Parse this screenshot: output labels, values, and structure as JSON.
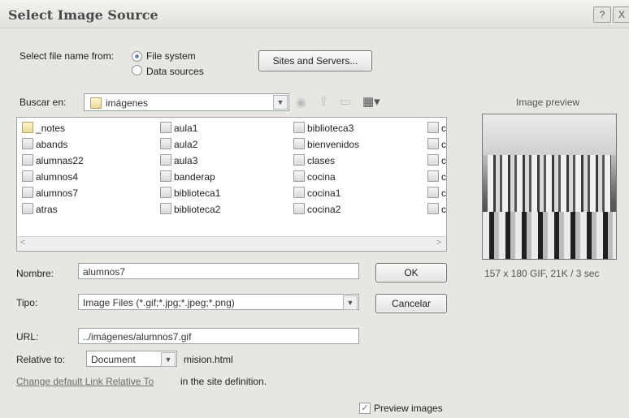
{
  "window": {
    "title": "Select Image Source",
    "help_glyph": "?",
    "close_glyph": "X"
  },
  "source": {
    "label": "Select file name from:",
    "options": [
      {
        "label": "File system",
        "selected": true
      },
      {
        "label": "Data sources",
        "selected": false
      }
    ],
    "sites_button": "Sites and Servers..."
  },
  "lookin": {
    "label": "Buscar en:",
    "value": "imágenes",
    "toolbar_icons": [
      "back-icon",
      "up-folder-icon",
      "new-folder-icon",
      "view-menu-icon"
    ]
  },
  "files": {
    "columns": [
      [
        "_notes",
        "abands",
        "alumnas22",
        "alumnos4",
        "alumnos7",
        "atras"
      ],
      [
        "aula1",
        "aula2",
        "aula3",
        "banderap",
        "biblioteca1",
        "biblioteca2"
      ],
      [
        "biblioteca3",
        "bienvenidos",
        "clases",
        "cocina",
        "cocina1",
        "cocina2"
      ],
      [
        "c",
        "c",
        "c",
        "c",
        "c",
        "c"
      ]
    ],
    "folder_items": [
      "_notes"
    ]
  },
  "preview": {
    "label": "Image preview",
    "info": "157 x 180 GIF, 21K / 3 sec"
  },
  "form": {
    "name_label": "Nombre:",
    "name_value": "alumnos7",
    "type_label": "Tipo:",
    "type_value": "Image Files (*.gif;*.jpg;*.jpeg;*.png)",
    "ok_button": "OK",
    "cancel_button": "Cancelar",
    "url_label": "URL:",
    "url_value": "../imágenes/alumnos7.gif",
    "relative_label": "Relative to:",
    "relative_value": "Document",
    "relative_file": "mision.html",
    "change_link": "Change default Link Relative To",
    "change_suffix": "in the site definition.",
    "preview_images_label": "Preview images",
    "preview_images_checked": true
  }
}
